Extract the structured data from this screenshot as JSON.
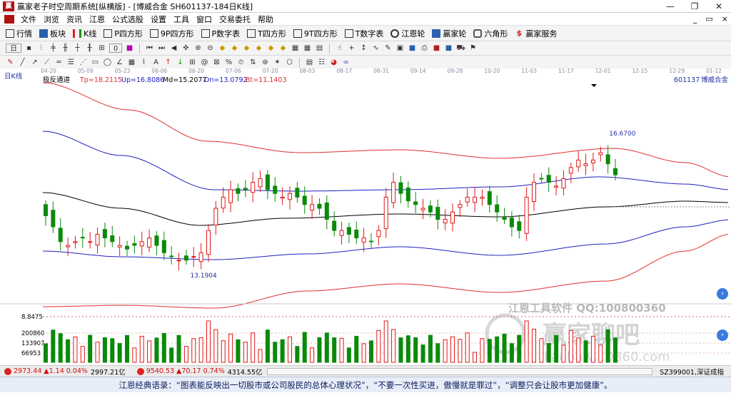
{
  "window": {
    "title": "赢家老子时空周期系统[纵横版] - [博威合金  SH601137-184日K线]",
    "controls": [
      "—",
      "❐",
      "✕"
    ]
  },
  "menu": [
    "文件",
    "浏览",
    "资讯",
    "江恩",
    "公式选股",
    "设置",
    "工具",
    "窗口",
    "交易委托",
    "帮助"
  ],
  "toolbar1": [
    {
      "label": "行情",
      "icon": "grid-icon"
    },
    {
      "label": "板块",
      "icon": "blocks-icon"
    },
    {
      "label": "K线",
      "icon": "kline-icon"
    },
    {
      "label": "P四方形",
      "icon": "p-square-icon"
    },
    {
      "label": "9P四方形",
      "icon": "9p-square-icon"
    },
    {
      "label": "P数字表",
      "icon": "p-table-icon"
    },
    {
      "label": "T四方形",
      "icon": "t-square-icon"
    },
    {
      "label": "9T四方形",
      "icon": "9t-square-icon"
    },
    {
      "label": "T数字表",
      "icon": "t-table-icon"
    },
    {
      "label": "江恩轮",
      "icon": "gann-wheel-icon"
    },
    {
      "label": "赢家轮",
      "icon": "winner-wheel-icon"
    },
    {
      "label": "六角形",
      "icon": "hexagon-icon"
    },
    {
      "label": "赢家服务",
      "icon": "dollar-icon"
    }
  ],
  "toolbar2_period": "日",
  "toolbar2_num": "0",
  "chart_data": [
    {
      "type": "candlestick",
      "period_label": "日K线",
      "indicator_name": "极反通道",
      "legend": [
        {
          "name": "Tp",
          "value": "18.2115",
          "color": "#e03030"
        },
        {
          "name": "Up",
          "value": "16.8086",
          "color": "#2020c0"
        },
        {
          "name": "Md",
          "value": "15.2077",
          "color": "#000000"
        },
        {
          "name": "Dn",
          "value": "13.0792",
          "color": "#2020c0"
        },
        {
          "name": "Bt",
          "value": "11.1403",
          "color": "#e03030"
        }
      ],
      "symbol": "601137",
      "symbol_name": "博威合金",
      "date_ticks": [
        "04-20",
        "05-09",
        "05-23",
        "06-06",
        "06-20",
        "07-06",
        "07-20",
        "08-03",
        "08-17",
        "08-31",
        "09-14",
        "09-28",
        "10-20",
        "11-03",
        "11-17",
        "12-01",
        "12-15",
        "12-29",
        "01-12"
      ],
      "annotations": [
        {
          "text": "16.6700",
          "kind": "high-marker"
        },
        {
          "text": "13.1904",
          "kind": "low-marker"
        }
      ],
      "price_approx": {
        "close": [
          14.7,
          14.4,
          14.0,
          13.9,
          14.0,
          14.1,
          14.0,
          14.2,
          14.1,
          14.0,
          13.9,
          13.8,
          13.9,
          14.0,
          14.1,
          13.9,
          13.7,
          13.6,
          13.5,
          13.5,
          13.6,
          13.7,
          14.3,
          14.9,
          15.2,
          15.4,
          15.3,
          15.4,
          15.6,
          15.7,
          15.4,
          15.3,
          15.2,
          15.3,
          15.2,
          15.0,
          15.0,
          14.9,
          14.6,
          14.3,
          14.3,
          14.2,
          14.1,
          14.1,
          14.0,
          14.3,
          15.2,
          15.6,
          15.3,
          15.1,
          15.0,
          14.9,
          14.8,
          14.6,
          14.6,
          14.8,
          15.0,
          15.2,
          15.2,
          15.2,
          15.0,
          14.8,
          14.6,
          14.4,
          14.3,
          15.2,
          15.6,
          15.7,
          15.6,
          15.5,
          15.7,
          16.0,
          16.2,
          16.1,
          16.2,
          16.4,
          16.1,
          15.8
        ]
      }
    },
    {
      "type": "bar",
      "name": "volume",
      "y_tick_labels": [
        "8.8475",
        "200860",
        "133907",
        "66953"
      ],
      "note": "volume bars, red = up day, green = down day"
    }
  ],
  "watermark": {
    "line1": "江恩工具软件  QQ:100800360",
    "line2": "赢家聊吧",
    "line3": "liaoba.v.10360.com"
  },
  "status": {
    "sh_value": "2973.44",
    "sh_change": "▲1.14",
    "sh_pct": "0.04%",
    "sh_amount": "2997.21亿",
    "sz_value": "9540.53",
    "sz_change": "▲70.17",
    "sz_pct": "0.74%",
    "sz_amount": "4314.55亿",
    "right_text": "SZ399001,深证成指"
  },
  "quote": "江恩经典语录：“图表能反映出一切股市或公司股民的总体心理状况”，“不要一次性买进，傲慢就是罪过”，“调整只会让股市更加健康”。",
  "colors": {
    "up": "#e01818",
    "down": "#0a8a0a",
    "band_outer": "#e03030",
    "band_inner": "#2020c0",
    "mid": "#000000"
  }
}
